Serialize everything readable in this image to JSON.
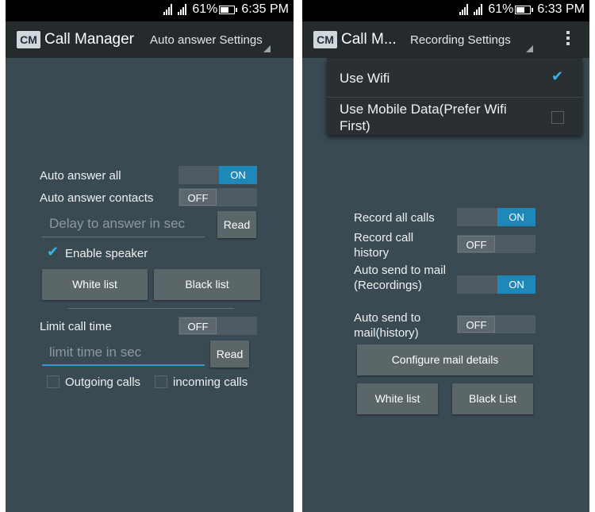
{
  "status_bar": {
    "battery": "61%",
    "time_left": "6:35 PM",
    "time_right": "6:33 PM"
  },
  "app": {
    "logo": "CM",
    "title_left": "Call Manager",
    "title_right": "Call M..."
  },
  "left": {
    "spinner": "Auto answer Settings",
    "auto_answer_all": {
      "label": "Auto answer all",
      "state": "ON"
    },
    "auto_answer_contacts": {
      "label": "Auto answer contacts",
      "state": "OFF"
    },
    "delay_placeholder": "Delay to answer in sec",
    "read_label": "Read",
    "enable_speaker": "Enable speaker",
    "white_list": "White list",
    "black_list": "Black list",
    "limit_call_time": {
      "label": "Limit call time",
      "state": "OFF"
    },
    "limit_placeholder": "limit time in sec",
    "outgoing_calls": "Outgoing calls",
    "incoming_calls": "incoming calls"
  },
  "right": {
    "spinner": "Recording Settings",
    "menu": {
      "use_wifi": "Use Wifi",
      "use_mobile_data": "Use Mobile Data(Prefer Wifi First)"
    },
    "record_all_calls": {
      "label": "Record all calls",
      "state": "ON"
    },
    "record_call_history": {
      "label": "Record call history",
      "state": "OFF"
    },
    "auto_send_recordings": {
      "label": "Auto send to mail(Recordings)",
      "state": "ON"
    },
    "auto_send_history": {
      "label": "Auto send to mail(history)",
      "state": "OFF"
    },
    "configure_mail": "Configure mail details",
    "white_list": "White list",
    "black_list": "Black List"
  },
  "icons": {
    "signal": "signal-icon",
    "battery": "battery-icon",
    "logo": "app-logo",
    "overflow": "overflow-menu-icon",
    "checkbox": "checkbox-icon",
    "dropdown_arrow": "dropdown-arrow-icon"
  },
  "colors": {
    "background": "#3a4a53",
    "action_bar": "#252a2d",
    "switch_on": "#1e88b8",
    "accent": "#38b2ea"
  }
}
